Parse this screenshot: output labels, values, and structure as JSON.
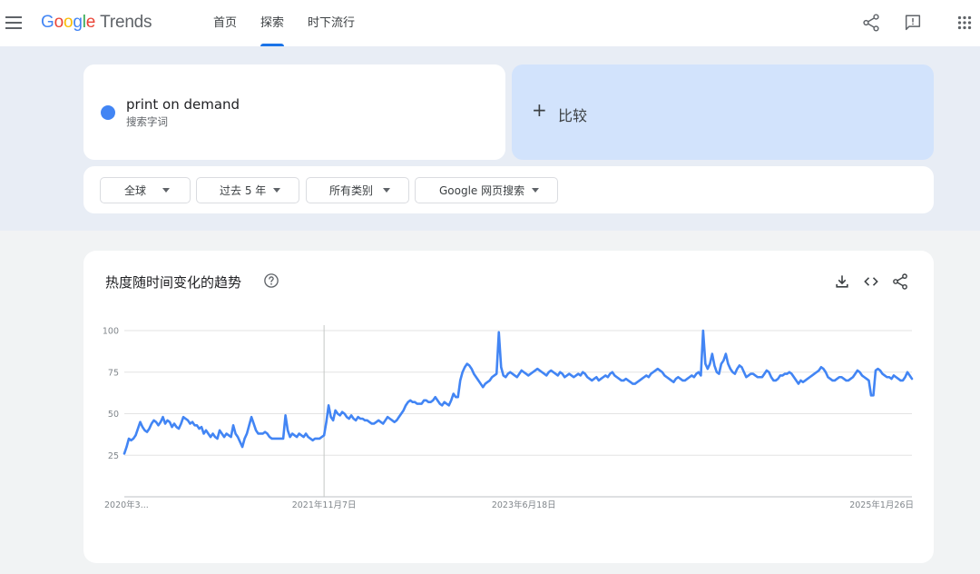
{
  "header": {
    "logo": {
      "google": [
        "G",
        "o",
        "o",
        "g",
        "l",
        "e"
      ],
      "product": "Trends"
    },
    "nav": [
      {
        "label": "首页",
        "active": false
      },
      {
        "label": "探索",
        "active": true
      },
      {
        "label": "时下流行",
        "active": false
      }
    ],
    "icons": [
      "menu-icon",
      "share-icon",
      "feedback-icon",
      "apps-grid-icon"
    ]
  },
  "search": {
    "term": "print on demand",
    "term_type": "搜索字词",
    "term_color": "#4285f4",
    "compare_label": "比较"
  },
  "filters": [
    {
      "label": "全球"
    },
    {
      "label": "过去 5 年"
    },
    {
      "label": "所有类别"
    },
    {
      "label": "Google 网页搜索"
    }
  ],
  "chart_card": {
    "title": "热度随时间变化的趋势",
    "icons": [
      "help-icon",
      "download-icon",
      "embed-icon",
      "share-icon"
    ]
  },
  "chart_data": {
    "type": "line",
    "y_ticks": [
      25,
      50,
      75,
      100
    ],
    "ylim": [
      0,
      100
    ],
    "x_tick_labels": [
      "2020年3...",
      "2021年11月7日",
      "2023年6月18日",
      "2025年1月26日"
    ],
    "x_tick_index": [
      0,
      88,
      176,
      264
    ],
    "partial_marker_index": 88,
    "grid": true,
    "series": [
      {
        "color": "#4285f4",
        "values": [
          26,
          30,
          35,
          34,
          35,
          37,
          41,
          45,
          42,
          40,
          39,
          41,
          44,
          46,
          45,
          43,
          45,
          48,
          44,
          46,
          45,
          42,
          44,
          42,
          41,
          44,
          48,
          47,
          46,
          44,
          45,
          43,
          43,
          41,
          42,
          38,
          40,
          38,
          36,
          38,
          36,
          35,
          40,
          38,
          36,
          38,
          37,
          36,
          43,
          38,
          36,
          33,
          30,
          35,
          38,
          43,
          48,
          44,
          40,
          38,
          38,
          38,
          39,
          38,
          36,
          35,
          35,
          35,
          35,
          35,
          35,
          49,
          40,
          36,
          38,
          37,
          36,
          38,
          37,
          36,
          38,
          36,
          35,
          34,
          35,
          35,
          35,
          36,
          37
        ],
        "values_b": [
          45,
          55,
          48,
          46,
          52,
          50,
          49,
          51,
          50,
          48,
          47,
          49,
          47,
          46,
          48,
          47,
          47,
          46,
          46,
          45,
          44,
          44,
          45,
          46,
          45,
          44,
          46,
          48,
          47,
          46,
          45,
          46,
          48,
          50,
          52,
          55,
          57,
          58,
          57,
          57,
          56,
          56,
          56,
          58,
          58,
          57,
          57,
          58,
          60,
          58,
          56,
          55,
          57,
          56,
          55,
          58,
          62,
          60,
          60,
          70,
          75,
          78,
          80,
          79,
          77,
          74,
          72,
          70,
          68,
          66,
          68,
          69,
          70,
          72,
          73,
          74,
          99,
          78,
          73,
          72,
          74,
          75,
          74,
          73,
          72,
          74,
          76,
          75,
          74,
          73,
          74,
          75,
          76,
          77,
          76,
          75,
          74,
          73,
          75,
          76,
          75,
          74,
          73,
          75,
          74,
          72,
          73,
          74,
          73,
          72,
          73,
          74,
          73,
          75,
          74,
          72,
          71,
          70,
          71,
          72,
          70,
          71,
          72,
          73,
          72,
          74,
          75,
          73,
          72,
          71,
          70,
          70,
          71,
          70,
          69,
          68,
          68,
          69,
          70,
          71,
          72,
          73,
          72,
          74,
          75,
          76,
          77,
          76,
          75,
          73,
          72,
          71,
          70,
          69
        ],
        "values_c": [
          71,
          72,
          71,
          70,
          70,
          71,
          72,
          73,
          72,
          74,
          75,
          73,
          100,
          80,
          77,
          80,
          86,
          79,
          75,
          74,
          80,
          82,
          86,
          80,
          77,
          75,
          74,
          77,
          79,
          78,
          75,
          72,
          73,
          74,
          74,
          73,
          72,
          72,
          72,
          74,
          76,
          75,
          72,
          70,
          70,
          71,
          73,
          73,
          74,
          74,
          75,
          74,
          72,
          70,
          68,
          70,
          69,
          70,
          71,
          72,
          73,
          74,
          75,
          76,
          78,
          77,
          75,
          72,
          71,
          70,
          70,
          71,
          72,
          72,
          71,
          70,
          70,
          71,
          72,
          74,
          76,
          75,
          73,
          72,
          71,
          70,
          61,
          61,
          76,
          77,
          76,
          74,
          73,
          72,
          72,
          71,
          73,
          72,
          71,
          70,
          70,
          72,
          75,
          73,
          71
        ]
      }
    ]
  }
}
